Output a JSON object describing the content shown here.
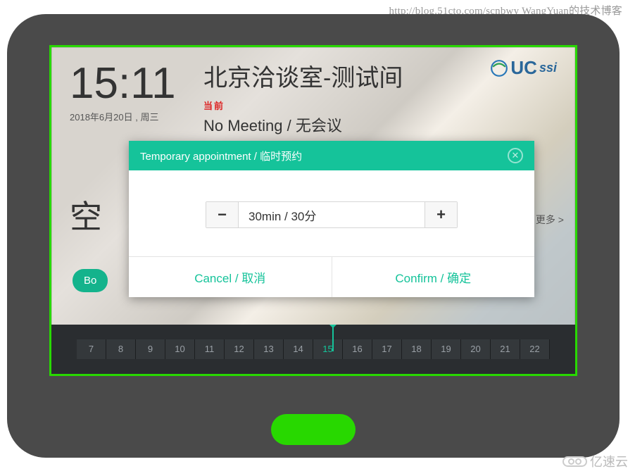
{
  "source_url": "http://blog.51cto.com/scnbwy WangYuan的技术博客",
  "brand": {
    "name": "UC",
    "suffix": "ssi"
  },
  "clock": {
    "time": "15:11",
    "date": "2018年6月20日 , 周三"
  },
  "room": {
    "name": "北京洽谈室-测试间",
    "current_label": "当前",
    "status": "No Meeting / 无会议"
  },
  "availability": {
    "badge_cn": "空"
  },
  "more": "/ 更多 >",
  "book_button": "Bo",
  "timeline": {
    "hours": [
      "7",
      "8",
      "9",
      "10",
      "11",
      "12",
      "13",
      "14",
      "15",
      "16",
      "17",
      "18",
      "19",
      "20",
      "21",
      "22"
    ],
    "current_index": 8
  },
  "modal": {
    "title": "Temporary appointment / 临时预约",
    "value": "30min / 30分",
    "minus": "−",
    "plus": "+",
    "cancel": "Cancel / 取消",
    "confirm": "Confirm / 确定",
    "close": "✕"
  },
  "watermark": "亿速云"
}
